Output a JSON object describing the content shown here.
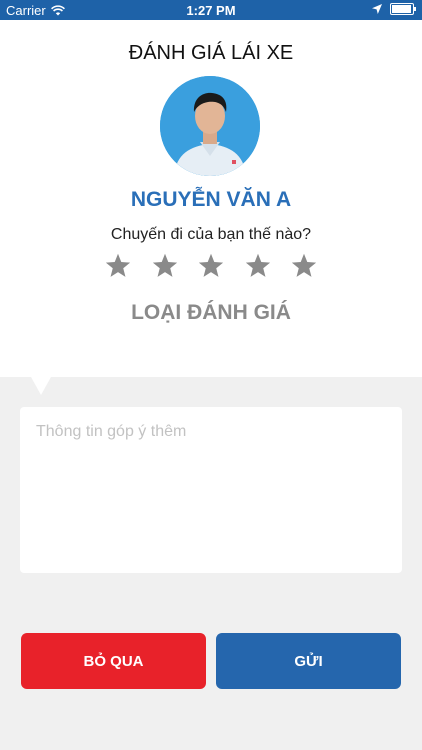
{
  "status_bar": {
    "carrier": "Carrier",
    "time": "1:27 PM"
  },
  "rating": {
    "title": "ĐÁNH GIÁ LÁI XE",
    "driver_name": "NGUYỄN VĂN A",
    "question": "Chuyến đi của bạn thế nào?",
    "stars_total": 5,
    "stars_selected": 0,
    "rating_type_label": "LOẠI ĐÁNH GIÁ"
  },
  "feedback": {
    "placeholder": "Thông tin góp ý thêm",
    "value": ""
  },
  "actions": {
    "skip_label": "BỎ QUA",
    "send_label": "GỬI"
  },
  "colors": {
    "status_bar": "#1e62a8",
    "name": "#2a6fb8",
    "star_empty": "#8a8a8a",
    "skip_button": "#e8222a",
    "send_button": "#2566ad",
    "background": "#f0f0f0"
  }
}
